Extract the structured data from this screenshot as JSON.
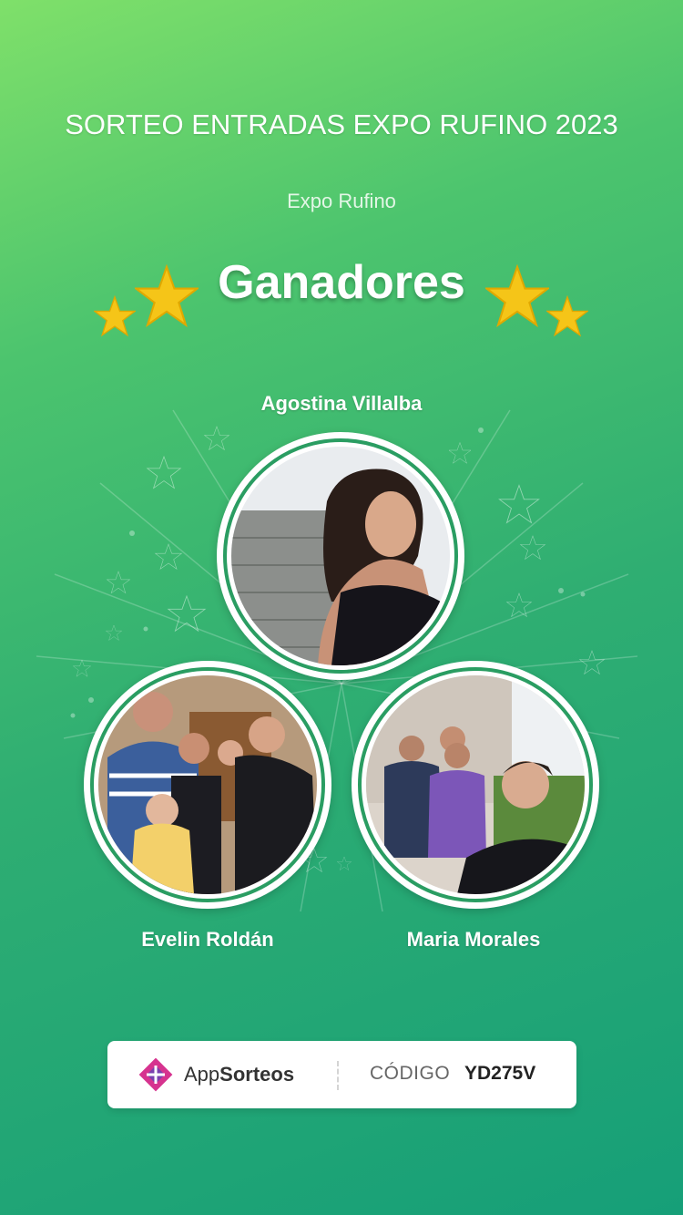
{
  "header": {
    "title": "SORTEO ENTRADAS EXPO RUFINO 2023",
    "subtitle": "Expo Rufino",
    "heading": "Ganadores"
  },
  "winners": [
    {
      "name": "Agostina Villalba",
      "photo": "portrait-photo"
    },
    {
      "name": "Evelin Roldán",
      "photo": "family-photo"
    },
    {
      "name": "Maria Morales",
      "photo": "group-selfie-photo"
    }
  ],
  "footer": {
    "brand_prefix": "App",
    "brand_suffix": "Sorteos",
    "code_label": "CÓDIGO",
    "code_value": "YD275V"
  },
  "colors": {
    "background_top": "#7fe06a",
    "background_bottom": "#169f78",
    "ring_accent": "#2a9d62",
    "star": "#f5c518",
    "logo_pink": "#d6338f",
    "logo_purple": "#7a3fb0"
  },
  "icons": [
    "star-icon",
    "appsorteos-logo-icon"
  ]
}
